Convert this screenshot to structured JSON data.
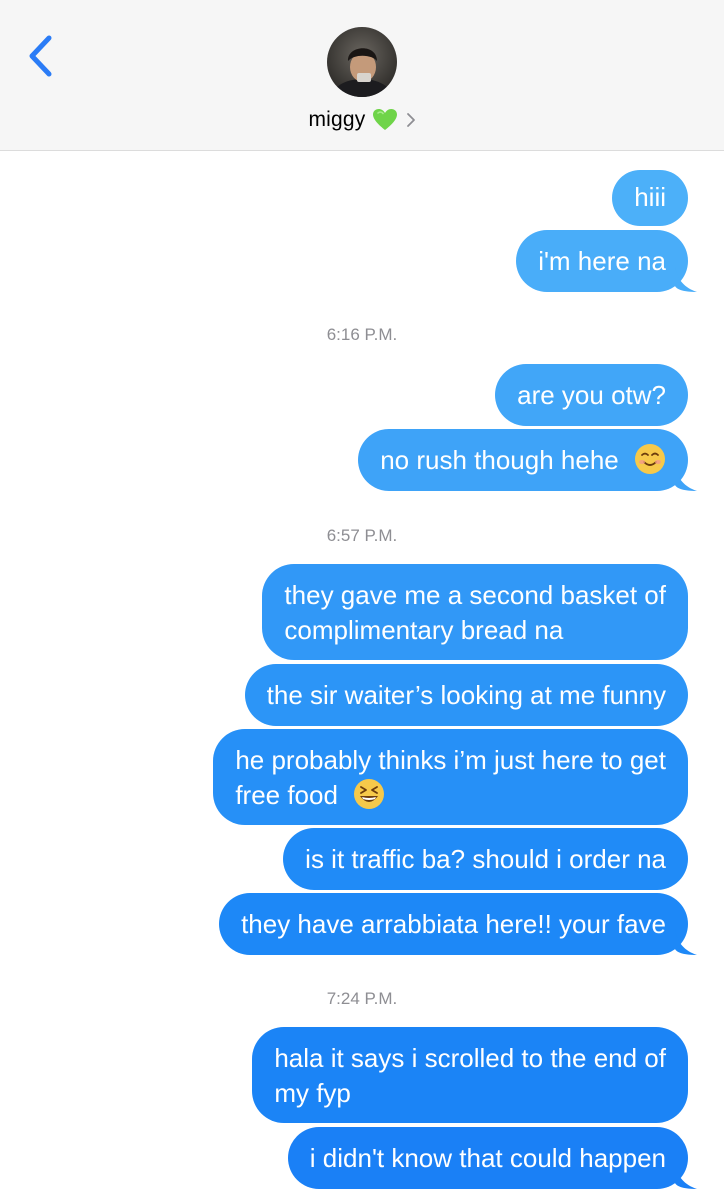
{
  "header": {
    "contact_name": "miggy",
    "colors": {
      "background": "#f6f6f6",
      "back_chevron": "#2b7cf6",
      "heart": "#6fd449"
    },
    "icons": [
      "chevron-left-icon",
      "avatar",
      "green-heart-icon",
      "chevron-right-icon"
    ]
  },
  "messages": [
    {
      "type": "bubble",
      "text": "hiii"
    },
    {
      "type": "bubble",
      "text": "i'm here na"
    },
    {
      "type": "timestamp",
      "text": "6:16 P.M."
    },
    {
      "type": "bubble",
      "text": "are you otw?"
    },
    {
      "type": "bubble",
      "text": "no rush though hehe",
      "emoji": "smiling-face-icon"
    },
    {
      "type": "timestamp",
      "text": "6:57 P.M."
    },
    {
      "type": "bubble",
      "lines": [
        "they gave me a second basket of",
        "complimentary bread na"
      ]
    },
    {
      "type": "bubble",
      "text": "the sir waiter’s looking at me funny"
    },
    {
      "type": "bubble",
      "lines": [
        "he probably thinks i’m just here to get",
        "free food"
      ],
      "emoji": "grinning-squinting-face-icon"
    },
    {
      "type": "bubble",
      "text": "is it traffic ba? should i order na"
    },
    {
      "type": "bubble",
      "text": "they have arrabbiata here!! your fave"
    },
    {
      "type": "timestamp",
      "text": "7:24 P.M."
    },
    {
      "type": "bubble",
      "lines": [
        "hala it says i scrolled to the end of",
        "my fyp"
      ]
    },
    {
      "type": "bubble",
      "text": "i didn't know that could happen"
    }
  ],
  "colors": {
    "bubble_top": "#4db0f9",
    "bubble_bottom": "#1a7ef6",
    "timestamp_text": "#8e8e93"
  }
}
